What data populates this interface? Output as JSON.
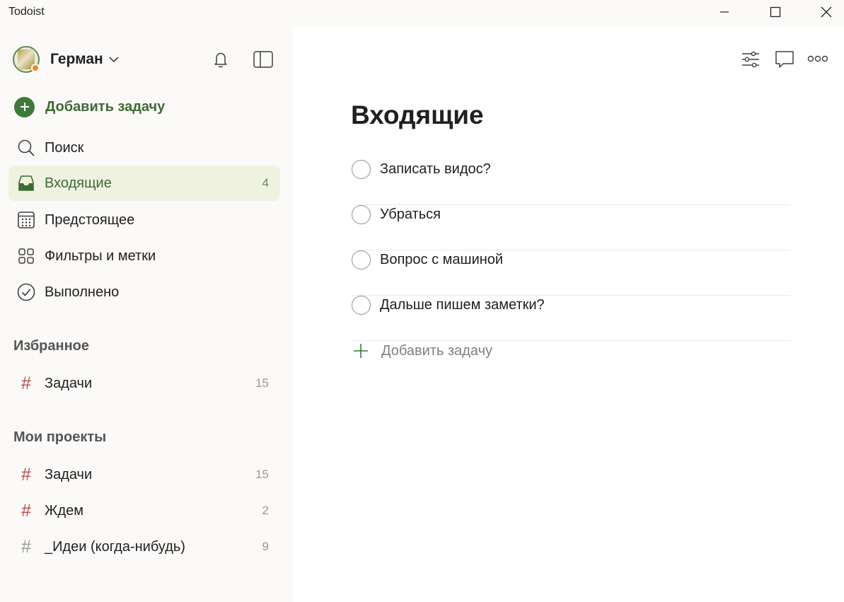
{
  "window": {
    "title": "Todoist"
  },
  "user": {
    "name": "Герман"
  },
  "sidebar": {
    "add_task_label": "Добавить задачу",
    "nav": [
      {
        "label": "Поиск",
        "icon": "search-icon"
      },
      {
        "label": "Входящие",
        "icon": "inbox-icon",
        "count": "4",
        "active": true
      },
      {
        "label": "Предстоящее",
        "icon": "calendar-icon"
      },
      {
        "label": "Фильтры и метки",
        "icon": "filters-grid-icon"
      },
      {
        "label": "Выполнено",
        "icon": "check-circle-icon"
      }
    ],
    "favorites_title": "Избранное",
    "favorites": [
      {
        "label": "Задачи",
        "count": "15",
        "hash_color": "#b8504a"
      }
    ],
    "projects_title": "Мои проекты",
    "projects": [
      {
        "label": "Задачи",
        "count": "15",
        "hash_color": "#b8504a"
      },
      {
        "label": "Ждем",
        "count": "2",
        "hash_color": "#b8504a"
      },
      {
        "label": "_Идеи (когда-нибудь)",
        "count": "9",
        "hash_color": "#9a9a9a"
      }
    ]
  },
  "main": {
    "title": "Входящие",
    "tasks": [
      {
        "text": "Записать видос?"
      },
      {
        "text": "Убраться"
      },
      {
        "text": "Вопрос с машиной"
      },
      {
        "text": "Дальше пишем заметки?"
      }
    ],
    "add_task_label": "Добавить задачу"
  },
  "colors": {
    "accent_green": "#3e7a39",
    "active_bg": "#eef2df",
    "project_hash": "#b8504a",
    "avatar_status": "#f08a24"
  }
}
